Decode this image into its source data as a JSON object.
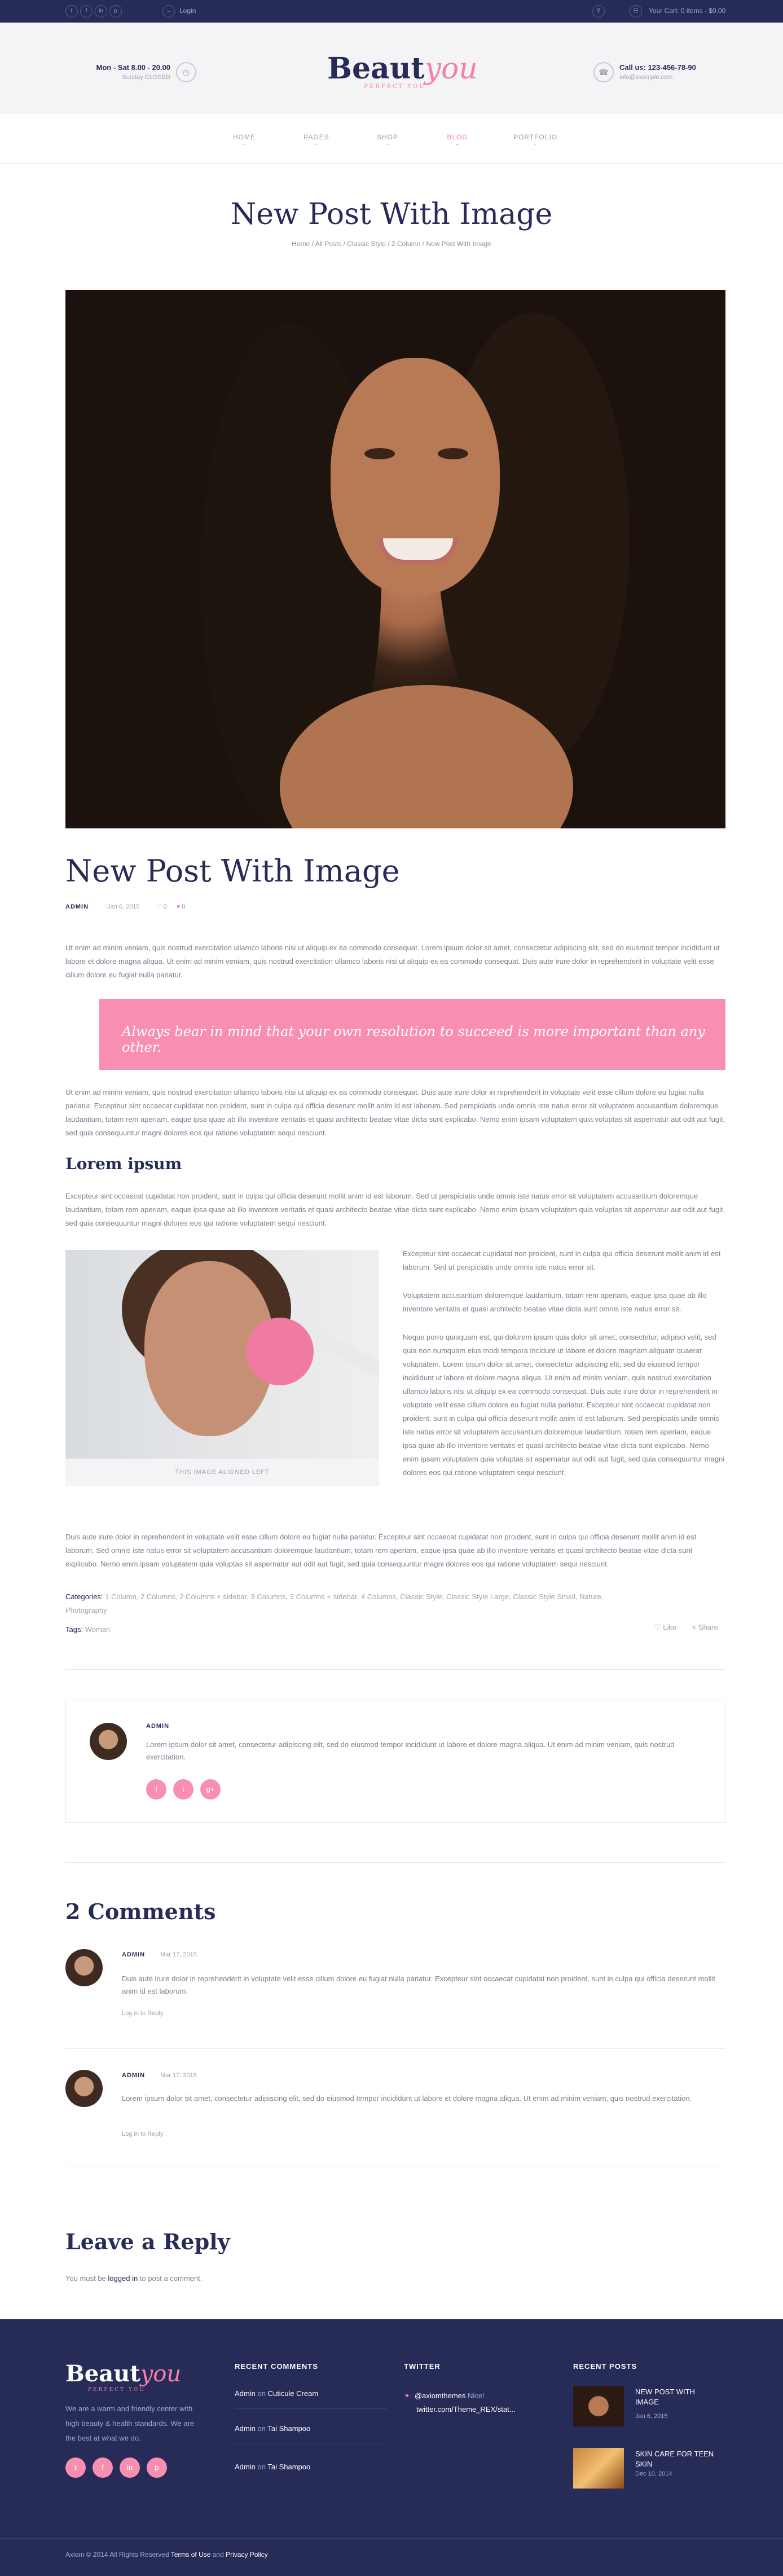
{
  "topbar": {
    "social": [
      "t",
      "f",
      "in",
      "p"
    ],
    "login": "Login",
    "cart": "Your Cart: 0 items - $0.00"
  },
  "header": {
    "hours": "Mon - Sat 8.00 - 20.00",
    "closed": "Sunday CLOSED",
    "logo_main": "Beaut",
    "logo_accent": "you",
    "logo_tagline": "PERFECT YOU",
    "phone": "Call us: 123-456-78-90",
    "email": "info@example.com"
  },
  "nav": {
    "items": [
      "HOME",
      "PAGES",
      "SHOP",
      "BLOG",
      "PORTFOLIO"
    ],
    "active": "BLOG"
  },
  "page": {
    "title": "New Post With Image",
    "breadcrumb": "Home / All Posts / Classic Style / 2 Column / New Post With Image"
  },
  "post": {
    "title": "New Post With Image",
    "author": "ADMIN",
    "date": "Jan 6, 2015",
    "likes1": "0",
    "likes2": "0",
    "intro": "Ut enim ad minim veniam, quis nostrud exercitation ullamco laboris nisi ut aliquip ex ea commodo consequat. Lorem ipsum dolor sit amet, consectetur adipiscing elit, sed do eiusmod tempor incididunt ut labore et dolore magna aliqua. Ut enim ad minim veniam, quis nostrud exercitation ullamco laboris nisi ut aliquip ex ea commodo consequat. Duis aute irure dolor in reprehenderit in voluptate velit esse cillum dolore eu fugiat nulla pariatur.",
    "quote": "Always bear in mind that your own resolution to succeed is more important than any other.",
    "para2": "Ut enim ad minim veniam, quis nostrud exercitation ullamco laboris nisi ut aliquip ex ea commodo consequat. Duis aute irure dolor in reprehenderit in voluptate velit esse cillum dolore eu fugiat nulla pariatur. Excepteur sint occaecat cupidatat non proident, sunt in culpa qui officia deserunt mollit anim id est laborum. Sed perspiciatis unde omnis iste natus error sit voluptatem accusantium doloremque laudantium, totam rem aperiam, eaque ipsa quae ab illo inventore veritatis et quasi architecto beatae vitae dicta sunt explicabo. Nemo enim ipsam voluptatem quia voluptas sit aspernatur aut odit aut fugit, sed quia consequuntur magni dolores eos qui ratione voluptatem sequi nesciunt.",
    "subheading": "Lorem ipsum",
    "para3": "Excepteur sint occaecat cupidatat non proident, sunt in culpa qui officia deserunt mollit anim id est laborum. Sed ut perspiciatis unde omnis iste natus error sit voluptatem accusantium doloremque laudantium, totam rem aperiam, eaque ipsa quae ab illo inventore veritatis et quasi architecto beatae vitae dicta sunt explicabo. Nemo enim ipsam voluptatem quia voluptas sit aspernatur aut odit aut fugit, sed quia consequuntur magni dolores eos qui ratione voluptatem sequi nesciunt.",
    "image_caption": "THIS IMAGE ALIGNED LEFT",
    "side1": "Excepteur sint occaecat cupidatat non proident, sunt in culpa qui officia deserunt mollit anim id est laborum. Sed ut perspiciatis unde omnis iste natus error sit.",
    "side2": "Voluptatem accusantium doloremque laudantium, totam rem aperiam, eaque ipsa quae ab illo inventore veritatis et quasi architecto beatae vitae dicta sunt omnis iste natus error sit.",
    "side3": "Neque porro quisquam est, qui dolorem ipsum quia dolor sit amet, consectetur, adipisci velit, sed quia non numquam eius modi tempora incidunt ut labore et dolore magnam aliquam quaerat voluptatem. Lorem ipsum dolor sit amet, consectetur adipiscing elit, sed do eiusmod tempor incididunt ut labore et dolore magna aliqua. Ut enim ad minim veniam, quis nostrud exercitation ullamco laboris nisi ut aliquip ex ea commodo consequat. Duis aute irure dolor in reprehenderit in voluptate velit esse cillum dolore eu fugiat nulla pariatur. Excepteur sint occaecat cupidatat non proident, sunt in culpa qui officia deserunt mollit anim id est laborum. Sed perspiciatis unde omnis iste natus error sit voluptatem accusantium doloremque laudantium, totam rem aperiam, eaque ipsa quae ab illo inventore veritatis et quasi architecto beatae vitae dicta sunt explicabo. Nemo enim ipsam voluptatem quia voluptas sit aspernatur aut odit aut fugit, sed quia consequuntur magni dolores eos qui ratione voluptatem sequi nesciunt.",
    "para4": "Duis aute irure dolor in reprehenderit in voluptate velit esse cillum dolore eu fugiat nulla pariatur. Excepteur sint occaecat cupidatat non proident, sunt in culpa qui officia deserunt mollit anim id est laborum. Sed omnis iste natus error sit voluptatem accusantium doloremque laudantium, totam rem aperiam, eaque ipsa quae ab illo inventore veritatis et quasi architecto beatae vitae dicta sunt explicabo. Nemo enim ipsam voluptatem quia voluptas sit aspernatur aut odit aut fugit, sed quia consequuntur magni dolores eos qui ratione voluptatem sequi nesciunt.",
    "categories_label": "Categories:",
    "categories": "1 Column, 2 Columns, 2 Columns + sidebar, 3 Columns, 3 Columns + sidebar, 4 Columns, Classic Style, Classic Style Large, Classic Style Small, Nature, Photography",
    "tags_label": "Tags:",
    "tags": "Woman",
    "like": "Like",
    "share": "Share"
  },
  "author_box": {
    "name": "ADMIN",
    "bio": "Lorem ipsum dolor sit amet, consectetur adipiscing elit, sed do eiusmod tempor incididunt ut labore et dolore magna aliqua. Ut enim ad minim veniam, quis nostrud exercitation.",
    "social": [
      "f",
      "t",
      "g+"
    ]
  },
  "comments": {
    "heading": "2 Comments",
    "items": [
      {
        "name": "ADMIN",
        "date": "Mar 17, 2015",
        "text": "Duis aute irure dolor in reprehenderit in voluptate velit esse cillum dolore eu fugiat nulla pariatur. Excepteur sint occaecat cupidatat non proident, sunt in culpa qui officia deserunt mollit anim id est laborum.",
        "reply": "Log in to Reply"
      },
      {
        "name": "ADMIN",
        "date": "Mar 17, 2015",
        "text": "Lorem ipsum dolor sit amet, consectetur adipiscing elit, sed do eiusmod tempor incididunt ut labore et dolore magna aliqua. Ut enim ad minim veniam, quis nostrud exercitation.",
        "reply": "Log in to Reply"
      }
    ]
  },
  "reply": {
    "heading": "Leave a Reply",
    "note_pre": "You must be",
    "note_link": "logged in",
    "note_post": "to post a comment."
  },
  "footer": {
    "logo_main": "Beaut",
    "logo_accent": "you",
    "tagline": "PERFECT YOU",
    "desc": "We are a warm and friendly center with high beauty & health standards. We are the best at what we do.",
    "social": [
      "t",
      "f",
      "in",
      "p"
    ],
    "recent_comments_h": "RECENT COMMENTS",
    "recent_comments": [
      {
        "who": "Admin",
        "on": "on",
        "what": "Cuticule Cream"
      },
      {
        "who": "Admin",
        "on": "on",
        "what": "Tai Shampoo"
      },
      {
        "who": "Admin",
        "on": "on",
        "what": "Tai Shampoo"
      }
    ],
    "twitter_h": "TWITTER",
    "twitter_handle": "@axiomthemes",
    "twitter_text": "Nice!",
    "twitter_link": "twitter.com/Theme_REX/stat...",
    "recent_posts_h": "RECENT POSTS",
    "recent_posts": [
      {
        "title": "NEW POST WITH IMAGE",
        "date": "Jan 6, 2015"
      },
      {
        "title": "SKIN CARE FOR TEEN SKIN",
        "date": "Dec 10, 2014"
      }
    ],
    "copyright": "Axiom © 2014 All Rights Reserved",
    "terms": "Terms of Use",
    "and": "and",
    "privacy": "Privacy Policy"
  }
}
